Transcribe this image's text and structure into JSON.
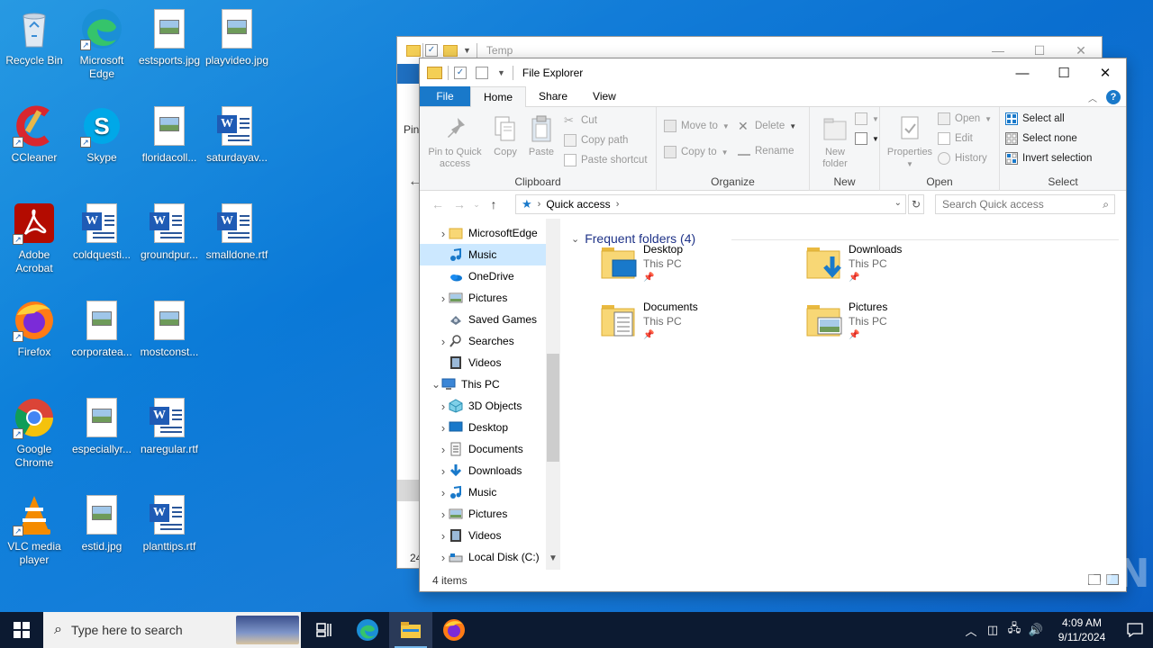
{
  "desktop": {
    "icons": [
      {
        "label": "Recycle Bin",
        "icon": "recycle-bin-icon"
      },
      {
        "label": "Microsoft Edge",
        "icon": "edge-icon"
      },
      {
        "label": "estsports.jpg",
        "icon": "image-file-icon"
      },
      {
        "label": "playvideo.jpg",
        "icon": "image-file-icon"
      },
      {
        "label": "CCleaner",
        "icon": "ccleaner-icon"
      },
      {
        "label": "Skype",
        "icon": "skype-icon"
      },
      {
        "label": "floridacoll...",
        "icon": "image-file-icon"
      },
      {
        "label": "saturdayav...",
        "icon": "word-file-icon"
      },
      {
        "label": "Adobe Acrobat",
        "icon": "acrobat-icon"
      },
      {
        "label": "coldquesti...",
        "icon": "word-file-icon"
      },
      {
        "label": "groundpur...",
        "icon": "word-file-icon"
      },
      {
        "label": "smalldone.rtf",
        "icon": "word-file-icon"
      },
      {
        "label": "Firefox",
        "icon": "firefox-icon"
      },
      {
        "label": "corporatea...",
        "icon": "image-file-icon"
      },
      {
        "label": "mostconst...",
        "icon": "image-file-icon"
      },
      {
        "label": "Google Chrome",
        "icon": "chrome-icon"
      },
      {
        "label": "especiallyr...",
        "icon": "image-file-icon"
      },
      {
        "label": "naregular.rtf",
        "icon": "word-file-icon"
      },
      {
        "label": "VLC media player",
        "icon": "vlc-icon"
      },
      {
        "label": "estid.jpg",
        "icon": "image-file-icon"
      },
      {
        "label": "planttips.rtf",
        "icon": "word-file-icon"
      }
    ]
  },
  "back_window": {
    "title": "Temp",
    "partial_label": "Pin",
    "partial_number": "24"
  },
  "explorer": {
    "title": "File Explorer",
    "tabs": [
      "File",
      "Home",
      "Share",
      "View"
    ],
    "ribbon": {
      "clipboard": {
        "name": "Clipboard",
        "pin_label_1": "Pin to Quick",
        "pin_label_2": "access",
        "copy": "Copy",
        "paste": "Paste",
        "cut": "Cut",
        "copy_path": "Copy path",
        "paste_shortcut": "Paste shortcut"
      },
      "organize": {
        "name": "Organize",
        "move_to": "Move to",
        "copy_to": "Copy to",
        "delete": "Delete",
        "rename": "Rename"
      },
      "new": {
        "name": "New",
        "new_folder_1": "New",
        "new_folder_2": "folder"
      },
      "open": {
        "name": "Open",
        "properties": "Properties",
        "open": "Open",
        "edit": "Edit",
        "history": "History"
      },
      "select": {
        "name": "Select",
        "select_all": "Select all",
        "select_none": "Select none",
        "invert": "Invert selection"
      }
    },
    "address": {
      "location": "Quick access",
      "search_placeholder": "Search Quick access"
    },
    "nav_pane": [
      {
        "label": "MicrosoftEdge",
        "icon": "folder-icon",
        "expandable": true,
        "indent": 1
      },
      {
        "label": "Music",
        "icon": "music-icon",
        "expandable": false,
        "indent": 1,
        "selected": true
      },
      {
        "label": "OneDrive",
        "icon": "onedrive-icon",
        "expandable": false,
        "indent": 1
      },
      {
        "label": "Pictures",
        "icon": "pictures-icon",
        "expandable": true,
        "indent": 1
      },
      {
        "label": "Saved Games",
        "icon": "saved-games-icon",
        "expandable": false,
        "indent": 1
      },
      {
        "label": "Searches",
        "icon": "search-icon",
        "expandable": true,
        "indent": 1
      },
      {
        "label": "Videos",
        "icon": "videos-icon",
        "expandable": false,
        "indent": 1
      },
      {
        "label": "This PC",
        "icon": "this-pc-icon",
        "expandable": true,
        "expanded": true,
        "indent": 0
      },
      {
        "label": "3D Objects",
        "icon": "3d-objects-icon",
        "expandable": true,
        "indent": 1
      },
      {
        "label": "Desktop",
        "icon": "desktop-icon",
        "expandable": true,
        "indent": 1
      },
      {
        "label": "Documents",
        "icon": "documents-icon",
        "expandable": true,
        "indent": 1
      },
      {
        "label": "Downloads",
        "icon": "downloads-icon",
        "expandable": true,
        "indent": 1
      },
      {
        "label": "Music",
        "icon": "music-icon",
        "expandable": true,
        "indent": 1
      },
      {
        "label": "Pictures",
        "icon": "pictures-icon",
        "expandable": true,
        "indent": 1
      },
      {
        "label": "Videos",
        "icon": "videos-icon",
        "expandable": true,
        "indent": 1
      },
      {
        "label": "Local Disk (C:)",
        "icon": "drive-icon",
        "expandable": true,
        "indent": 1
      }
    ],
    "frequent": {
      "header": "Frequent folders (4)",
      "items": [
        {
          "name": "Desktop",
          "location": "This PC",
          "icon": "desktop-folder-icon"
        },
        {
          "name": "Downloads",
          "location": "This PC",
          "icon": "downloads-folder-icon"
        },
        {
          "name": "Documents",
          "location": "This PC",
          "icon": "documents-folder-icon"
        },
        {
          "name": "Pictures",
          "location": "This PC",
          "icon": "pictures-folder-icon"
        }
      ]
    },
    "status": "4 items"
  },
  "taskbar": {
    "search_placeholder": "Type here to search",
    "time": "4:09 AM",
    "date": "9/11/2024"
  },
  "watermark": "ANY RUN",
  "colors": {
    "accent": "#1979ca",
    "selection": "#cce8ff",
    "taskbar": "#0c1a31",
    "folder": "#f8d775"
  }
}
